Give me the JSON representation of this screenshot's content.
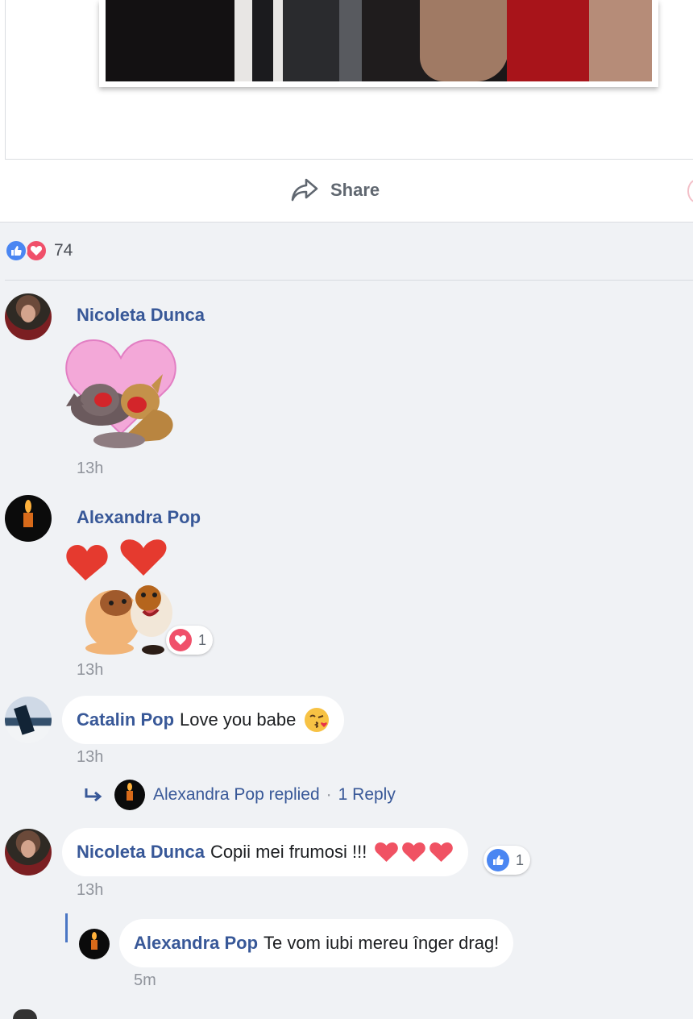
{
  "post": {
    "share_label": "Share",
    "reaction_count": "74",
    "reaction_types": [
      "like",
      "love"
    ]
  },
  "colors": {
    "link": "#385898",
    "like_blue": "#4a86f2",
    "love_red": "#f0506a",
    "background": "#f0f2f5",
    "meta_gray": "#90949c"
  },
  "comments": [
    {
      "author": "Nicoleta Dunca",
      "type": "sticker",
      "sticker": "dogs-kissing-heart-sticker",
      "time": "13h"
    },
    {
      "author": "Alexandra Pop",
      "type": "sticker",
      "sticker": "dogs-hugging-hearts-sticker",
      "time": "13h",
      "reaction": {
        "type": "love",
        "count": "1"
      }
    },
    {
      "author": "Catalin Pop",
      "type": "text",
      "text": "Love you babe",
      "emoji": "kissing-face-icon",
      "time": "13h",
      "replies_summary": {
        "text": "Alexandra Pop replied",
        "count_label": "1 Reply"
      }
    },
    {
      "author": "Nicoleta Dunca",
      "type": "text",
      "text": "Copii mei frumosi !!!",
      "emoji": "three-hearts",
      "time": "13h",
      "reaction": {
        "type": "like",
        "count": "1"
      },
      "replies": [
        {
          "author": "Alexandra Pop",
          "text": "Te vom iubi mereu înger drag!",
          "time": "5m"
        }
      ]
    }
  ]
}
